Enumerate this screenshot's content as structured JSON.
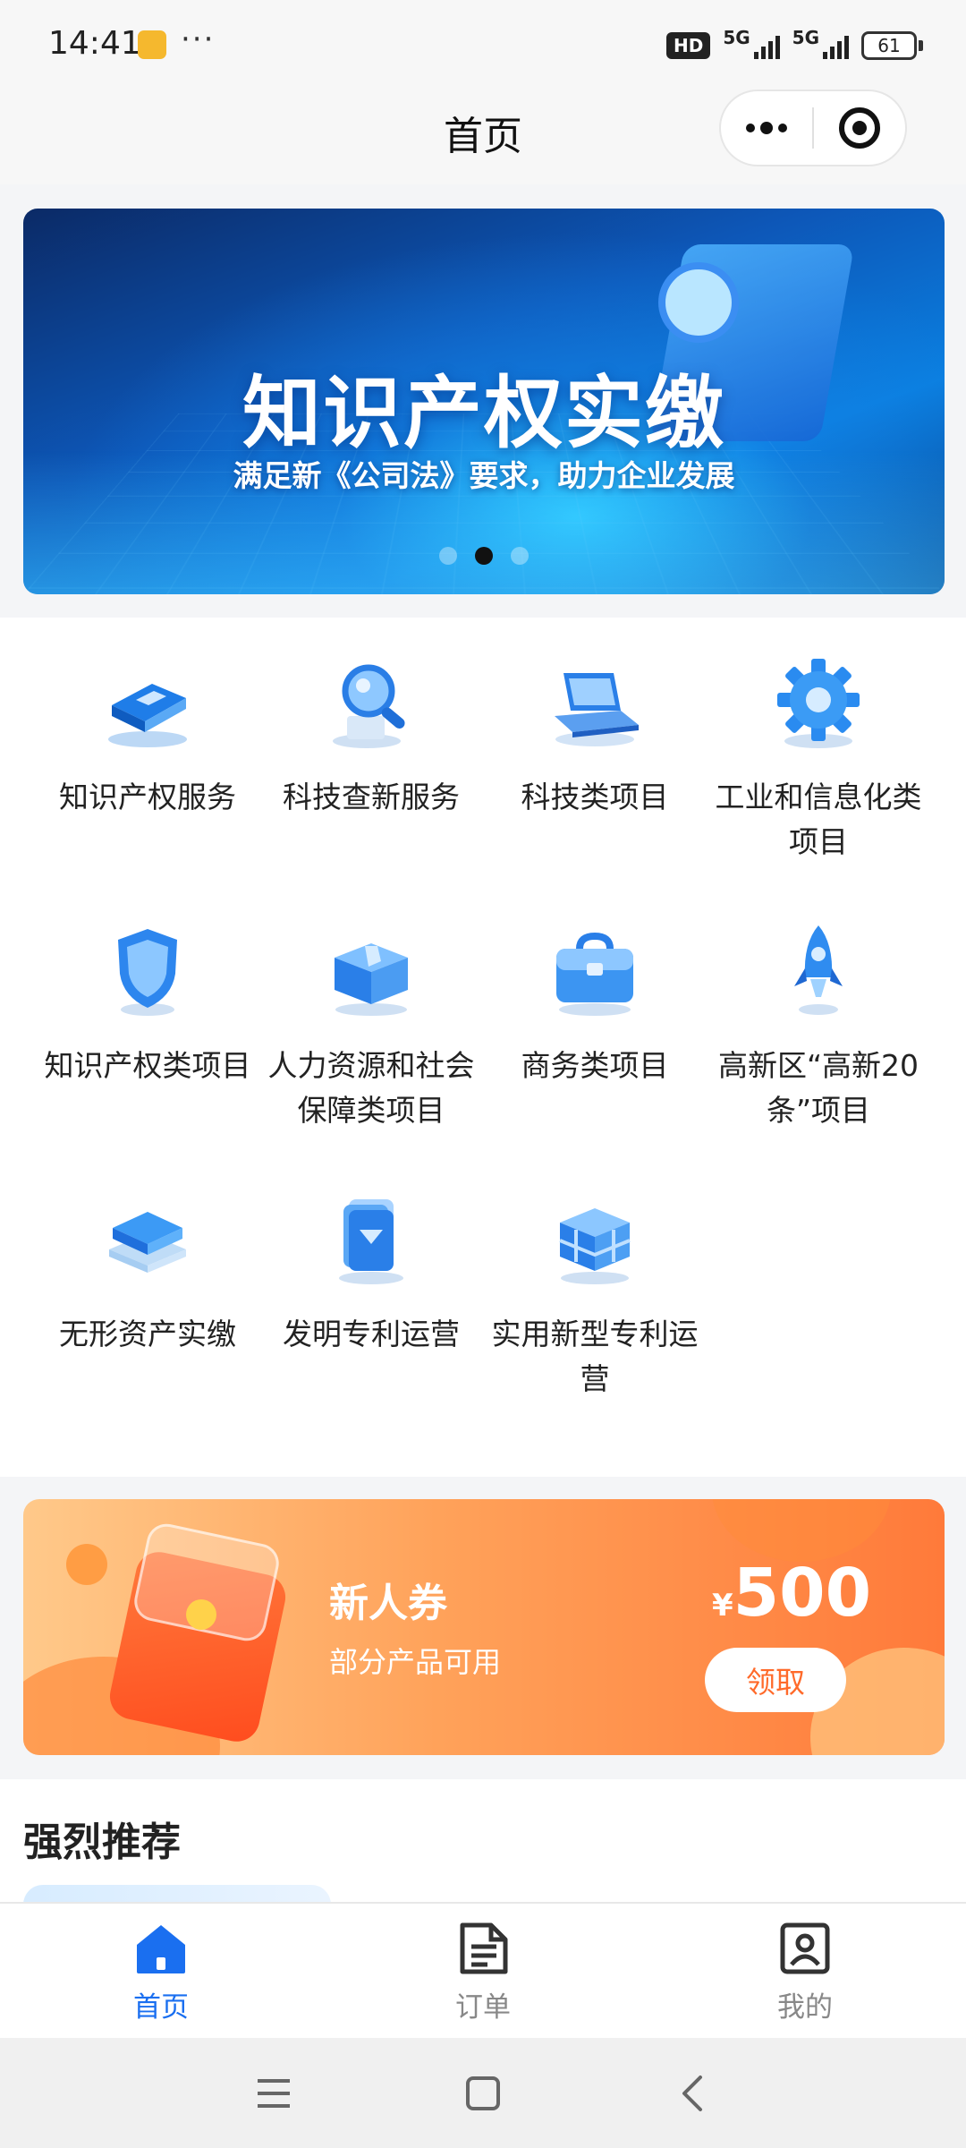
{
  "status_bar": {
    "time": "14:41",
    "more": "···",
    "hd": "HD",
    "net1": "5G",
    "net2": "5G",
    "battery": "61"
  },
  "nav": {
    "title": "首页"
  },
  "banner": {
    "title": "知识产权实缴",
    "subtitle": "满足新《公司法》要求，助力企业发展",
    "slides": 3,
    "active_slide": 2
  },
  "services": [
    {
      "label": "知识产权服务",
      "icon": "book-icon"
    },
    {
      "label": "科技查新服务",
      "icon": "magnifier-icon"
    },
    {
      "label": "科技类项目",
      "icon": "laptop-icon"
    },
    {
      "label": "工业和信息化类项目",
      "icon": "gear-icon"
    },
    {
      "label": "知识产权类项目",
      "icon": "shield-icon"
    },
    {
      "label": "人力资源和社会保障类项目",
      "icon": "box-icon"
    },
    {
      "label": "商务类项目",
      "icon": "briefcase-icon"
    },
    {
      "label": "高新区“高新20条”项目",
      "icon": "rocket-icon"
    },
    {
      "label": "无形资产实缴",
      "icon": "layers-icon"
    },
    {
      "label": "发明专利运营",
      "icon": "document-stack-icon"
    },
    {
      "label": "实用新型专利运营",
      "icon": "cubes-icon"
    }
  ],
  "coupon": {
    "title": "新人券",
    "subtitle": "部分产品可用",
    "currency": "¥",
    "amount": "500",
    "button": "领取"
  },
  "recommend": {
    "title": "强烈推荐"
  },
  "tabs": [
    {
      "label": "首页",
      "icon": "home-icon",
      "active": true
    },
    {
      "label": "订单",
      "icon": "order-icon",
      "active": false
    },
    {
      "label": "我的",
      "icon": "profile-icon",
      "active": false
    }
  ],
  "colors": {
    "accent": "#1a6ff0",
    "coupon_orange": "#ff7a3a",
    "banner_blue": "#0d57b8"
  }
}
